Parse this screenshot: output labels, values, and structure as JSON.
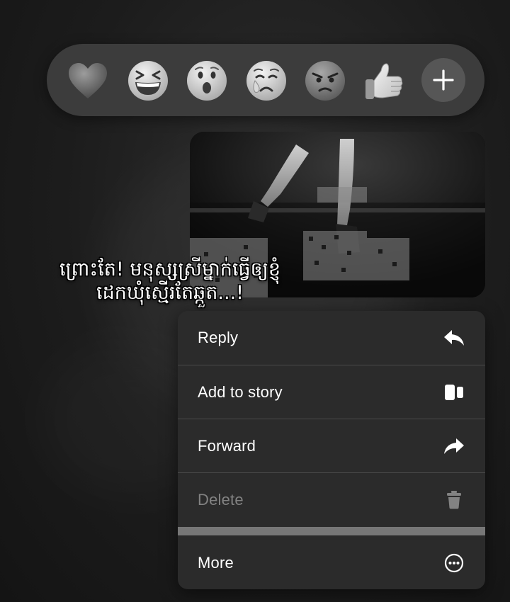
{
  "reactions": [
    {
      "name": "heart-emoji"
    },
    {
      "name": "laughing-emoji"
    },
    {
      "name": "wow-emoji"
    },
    {
      "name": "crying-emoji"
    },
    {
      "name": "angry-emoji"
    },
    {
      "name": "thumbs-up-emoji"
    }
  ],
  "reaction_add_icon": "plus-icon",
  "message": {
    "caption_line1": "ព្រោះតែ! មនុស្សស្រីម្នាក់ធ្វើឲ្យខ្ញុំ",
    "caption_line2": "ដេកឃុំស្មើរតែឆ្កួត...!"
  },
  "menu": {
    "items": [
      {
        "label": "Reply",
        "icon": "reply-icon",
        "enabled": true
      },
      {
        "label": "Add to story",
        "icon": "story-icon",
        "enabled": true
      },
      {
        "label": "Forward",
        "icon": "forward-icon",
        "enabled": true
      },
      {
        "label": "Delete",
        "icon": "trash-icon",
        "enabled": false
      },
      {
        "label": "More",
        "icon": "more-icon",
        "enabled": true
      }
    ]
  },
  "colors": {
    "background": "#1c1c1c",
    "menu_background": "#2b2b2b",
    "reaction_bar": "#3c3c3c",
    "disabled_text": "#828282"
  }
}
